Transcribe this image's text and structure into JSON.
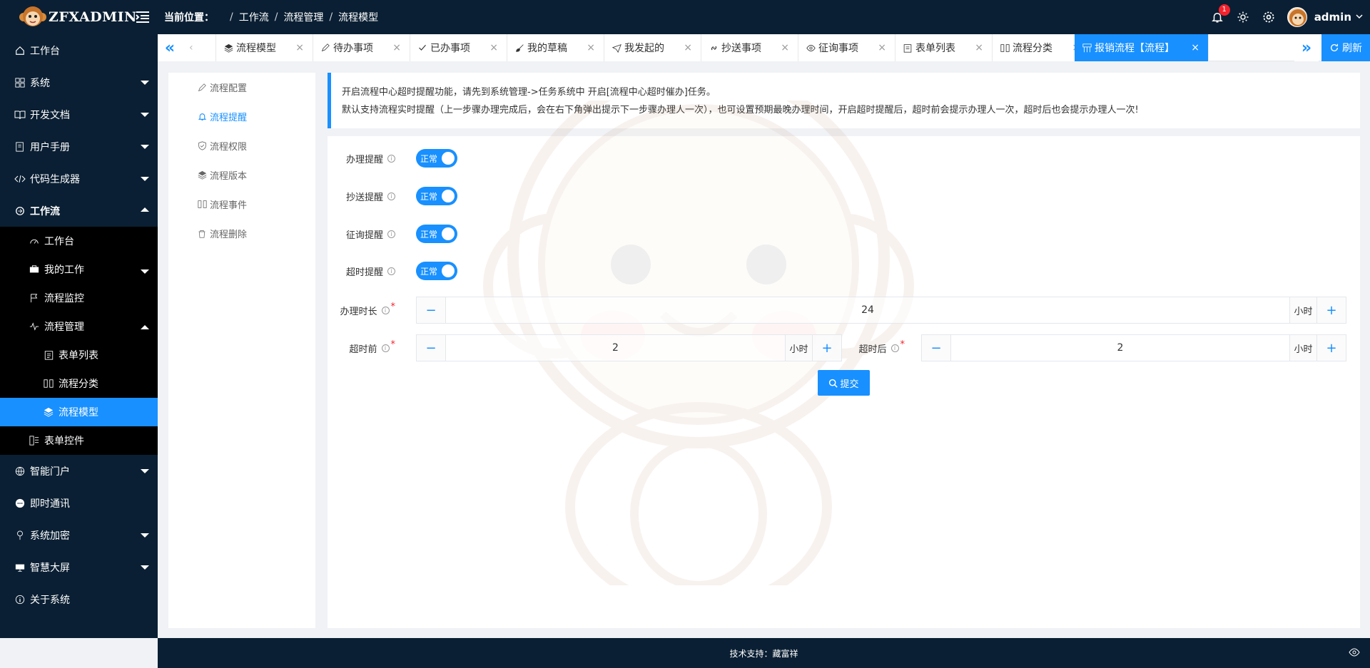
{
  "app": {
    "logo_text": "ZFXADMIN"
  },
  "breadcrumb": {
    "label": "当前位置：",
    "items": [
      "工作流",
      "流程管理",
      "流程模型"
    ]
  },
  "topbar": {
    "notification_count": "1",
    "username": "admin"
  },
  "sidebar": {
    "items": [
      {
        "label": "工作台",
        "icon": "home-icon"
      },
      {
        "label": "系统",
        "icon": "grid-icon"
      },
      {
        "label": "开发文档",
        "icon": "book-icon"
      },
      {
        "label": "用户手册",
        "icon": "manual-icon"
      },
      {
        "label": "代码生成器",
        "icon": "code-icon"
      },
      {
        "label": "工作流",
        "icon": "workflow-icon"
      },
      {
        "label": "智能门户",
        "icon": "globe-icon"
      },
      {
        "label": "即时通讯",
        "icon": "chat-icon"
      },
      {
        "label": "系统加密",
        "icon": "location-icon"
      },
      {
        "label": "智慧大屏",
        "icon": "screen-icon"
      },
      {
        "label": "关于系统",
        "icon": "info-icon"
      }
    ],
    "workflow_children": [
      {
        "label": "工作台",
        "icon": "dashboard-icon"
      },
      {
        "label": "我的工作",
        "icon": "briefcase-icon"
      },
      {
        "label": "流程监控",
        "icon": "flag-icon"
      },
      {
        "label": "流程管理",
        "icon": "pulse-icon"
      },
      {
        "label": "表单控件",
        "icon": "form-control-icon"
      }
    ],
    "process_children": [
      {
        "label": "表单列表",
        "icon": "clipboard-icon"
      },
      {
        "label": "流程分类",
        "icon": "columns-icon"
      },
      {
        "label": "流程模型",
        "icon": "layers-icon"
      }
    ]
  },
  "tabs": {
    "items": [
      {
        "label": "流程模型",
        "icon": "layers-icon"
      },
      {
        "label": "待办事项",
        "icon": "pencil-icon"
      },
      {
        "label": "已办事项",
        "icon": "check-icon"
      },
      {
        "label": "我的草稿",
        "icon": "brush-icon"
      },
      {
        "label": "我发起的",
        "icon": "send-icon"
      },
      {
        "label": "抄送事项",
        "icon": "link-icon"
      },
      {
        "label": "征询事项",
        "icon": "eye-icon"
      },
      {
        "label": "表单列表",
        "icon": "clipboard-icon"
      },
      {
        "label": "流程分类",
        "icon": "columns-icon"
      },
      {
        "label": "报销流程【流程】",
        "icon": "model-icon"
      }
    ],
    "close_glyph": "×",
    "refresh_label": "刷新"
  },
  "submenu": {
    "items": [
      {
        "label": "流程配置",
        "icon": "pencil-icon"
      },
      {
        "label": "流程提醒",
        "icon": "bell-icon"
      },
      {
        "label": "流程权限",
        "icon": "shield-icon"
      },
      {
        "label": "流程版本",
        "icon": "layers-icon"
      },
      {
        "label": "流程事件",
        "icon": "columns-icon"
      },
      {
        "label": "流程删除",
        "icon": "trash-icon"
      }
    ]
  },
  "notice": {
    "line1": "开启流程中心超时提醒功能，请先到系统管理->任务系统中 开启[流程中心超时催办]任务。",
    "line2": "默认支持流程实时提醒（上一步骤办理完成后，会在右下角弹出提示下一步骤办理人一次），也可设置预期最晚办理时间，开启超时提醒后，超时前会提示办理人一次，超时后也会提示办理人一次!"
  },
  "form": {
    "switches": [
      {
        "label": "办理提醒",
        "state": "正常"
      },
      {
        "label": "抄送提醒",
        "state": "正常"
      },
      {
        "label": "征询提醒",
        "state": "正常"
      },
      {
        "label": "超时提醒",
        "state": "正常"
      }
    ],
    "duration": {
      "label": "办理时长",
      "value": "24",
      "unit": "小时"
    },
    "before": {
      "label": "超时前",
      "value": "2",
      "unit": "小时"
    },
    "after": {
      "label": "超时后",
      "value": "2",
      "unit": "小时"
    },
    "minus_glyph": "−",
    "plus_glyph": "+",
    "submit_label": "提交"
  },
  "footer": {
    "text": "技术支持：藏富祥"
  },
  "colors": {
    "primary": "#1890ff",
    "dark": "#0a1f33",
    "badge": "#f5222d"
  }
}
